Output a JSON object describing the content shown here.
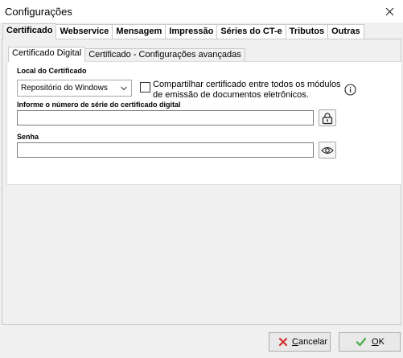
{
  "window": {
    "title": "Configurações",
    "close_icon": "close-icon"
  },
  "main_tabs": [
    {
      "label": "Certificado",
      "active": true
    },
    {
      "label": "Webservice",
      "active": false
    },
    {
      "label": "Mensagem",
      "active": false
    },
    {
      "label": "Impressão",
      "active": false
    },
    {
      "label": "Séries do CT-e",
      "active": false
    },
    {
      "label": "Tributos",
      "active": false
    },
    {
      "label": "Outras",
      "active": false
    }
  ],
  "sub_tabs": [
    {
      "label": "Certificado Digital",
      "active": true
    },
    {
      "label": "Certificado - Configurações avançadas",
      "active": false
    }
  ],
  "form": {
    "local_label": "Local do Certificado",
    "local_value": "Repositório do Windows",
    "share_checkbox_checked": false,
    "share_label_line1": "Compartilhar certificado entre todos os módulos",
    "share_label_line2": "de emissão de documentos eletrônicos.",
    "serial_label": "Informe o número de série do certificado digital",
    "serial_value": "",
    "password_label": "Senha",
    "password_value": ""
  },
  "footer": {
    "cancel_label_underlined": "C",
    "cancel_label_rest": "ancelar",
    "ok_label_underlined": "O",
    "ok_label_rest": "K"
  },
  "colors": {
    "cancel_icon": "#d32f2f",
    "ok_icon": "#4caf50",
    "background": "#f0f0f0"
  }
}
